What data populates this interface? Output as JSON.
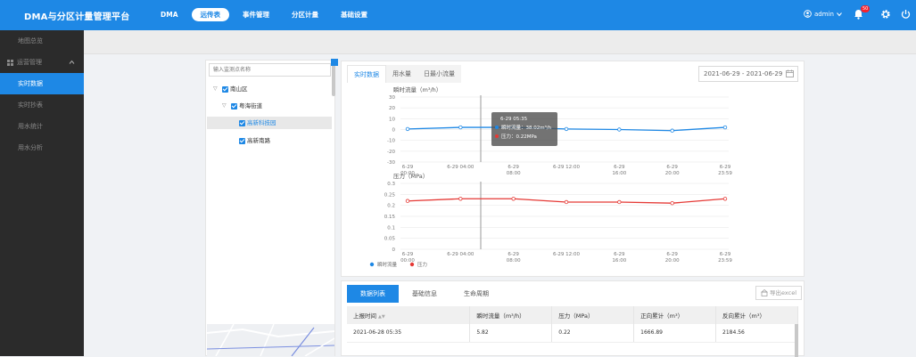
{
  "header": {
    "brand": "DMA与分区计量管理平台",
    "nav": [
      "DMA",
      "远传表",
      "事件管理",
      "分区计量",
      "基础设置"
    ],
    "active_nav": 1,
    "user": "admin",
    "notification_count": "50",
    "icons": [
      "user-icon",
      "bell-icon",
      "gear-icon",
      "power-icon"
    ]
  },
  "sidebar": {
    "items": [
      {
        "label": "地图总览",
        "type": "item"
      },
      {
        "label": "运营管理",
        "type": "group"
      },
      {
        "label": "实时数据",
        "type": "item",
        "active": true
      },
      {
        "label": "实时抄表",
        "type": "item"
      },
      {
        "label": "用水统计",
        "type": "item"
      },
      {
        "label": "用水分析",
        "type": "item"
      }
    ]
  },
  "tree": {
    "search_placeholder": "输入监测点名称",
    "nodes": [
      {
        "label": "南山区",
        "level": 0
      },
      {
        "label": "粤海街道",
        "level": 1
      },
      {
        "label": "高新科技园",
        "level": 2,
        "selected": true
      },
      {
        "label": "高新南路",
        "level": 2
      }
    ]
  },
  "chart_panel": {
    "tabs": [
      "实时数据",
      "用水量",
      "日最小流量"
    ],
    "active_tab": 0,
    "date_range": "2021-06-29 - 2021-06-29"
  },
  "chart_data": [
    {
      "type": "line",
      "title": "瞬时流量（m³/h）",
      "x": [
        "6-29 00:00",
        "6-29 04:00",
        "6-29 08:00",
        "6-29 12:00",
        "6-29 16:00",
        "6-29 20:00",
        "6-29 23:59"
      ],
      "x_tick_labels": [
        [
          "6-29",
          "00:00"
        ],
        [
          "6-29 04:00"
        ],
        [
          "6-29",
          "08:00"
        ],
        [
          "6-29 12:00"
        ],
        [
          "6-29",
          "16:00"
        ],
        [
          "6-29",
          "20:00"
        ],
        [
          "6-29",
          "23:59"
        ]
      ],
      "series": [
        {
          "name": "瞬时流量",
          "color": "#1e88e5",
          "values": [
            0.5,
            2,
            2,
            0.5,
            0,
            -1,
            2
          ]
        }
      ],
      "ylim": [
        -30,
        30
      ],
      "yticks": [
        30,
        20,
        10,
        0,
        -10,
        -20,
        -30
      ],
      "grid": true
    },
    {
      "type": "line",
      "title": "压力（MPa）",
      "x": [
        "6-29 00:00",
        "6-29 04:00",
        "6-29 08:00",
        "6-29 12:00",
        "6-29 16:00",
        "6-29 20:00",
        "6-29 23:59"
      ],
      "x_tick_labels": [
        [
          "6-29",
          "00:00"
        ],
        [
          "6-29 04:00"
        ],
        [
          "6-29",
          "08:00"
        ],
        [
          "6-29 12:00"
        ],
        [
          "6-29",
          "16:00"
        ],
        [
          "6-29",
          "20:00"
        ],
        [
          "6-29",
          "23:59"
        ]
      ],
      "series": [
        {
          "name": "压力",
          "color": "#e53935",
          "values": [
            0.22,
            0.23,
            0.23,
            0.215,
            0.215,
            0.21,
            0.23
          ]
        }
      ],
      "ylim": [
        0,
        0.3
      ],
      "yticks": [
        0.3,
        0.25,
        0.2,
        0.15,
        0.1,
        0.05,
        0
      ],
      "grid": true
    }
  ],
  "tooltip": {
    "time": "6-29  05:35",
    "flow_label": "瞬时流量：38.02m³/h",
    "pressure_label": "压力：0.22MPa"
  },
  "legend": [
    "瞬时流量",
    "压力"
  ],
  "table_panel": {
    "tabs": [
      "数据列表",
      "基础信息",
      "生命周期"
    ],
    "active_tab": 0,
    "export_label": "导出excel",
    "columns": [
      "上报时间",
      "瞬时流量（m³/h）",
      "压力（MPa）",
      "正向累计（m³）",
      "反向累计（m³）"
    ],
    "rows": [
      [
        "2021-06-28 05:35",
        "5.82",
        "0.22",
        "1666.89",
        "2184.56"
      ]
    ]
  }
}
